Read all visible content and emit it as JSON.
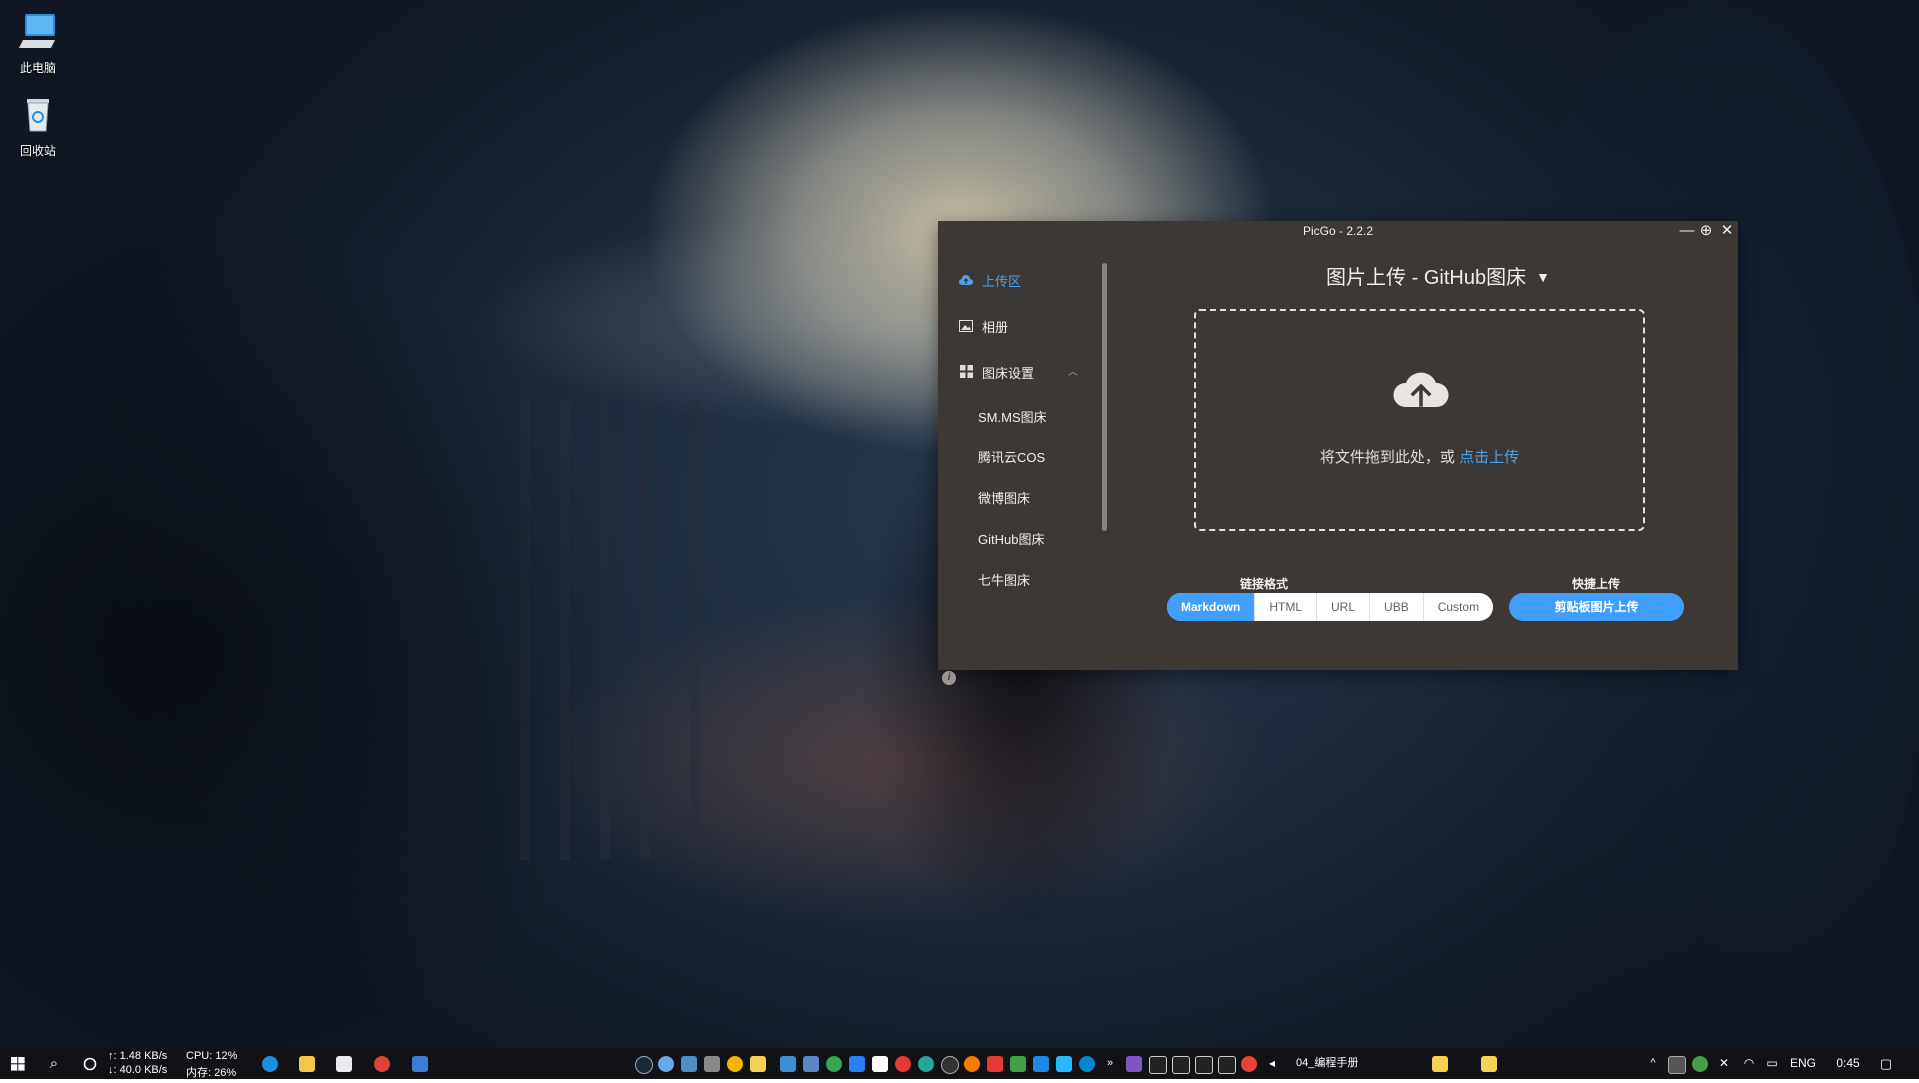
{
  "desktop": {
    "icons": [
      {
        "label": "此电脑",
        "icon": "computer-icon"
      },
      {
        "label": "回收站",
        "icon": "recycle-bin-icon"
      }
    ]
  },
  "window": {
    "title": "PicGo - 2.2.2",
    "controls": {
      "minimize": "—",
      "pin": "⊕",
      "close": "✕"
    }
  },
  "sidebar": {
    "items": [
      {
        "label": "上传区",
        "icon": "cloud-upload-icon",
        "active": true
      },
      {
        "label": "相册",
        "icon": "image-icon"
      },
      {
        "label": "图床设置",
        "icon": "grid-icon",
        "expanded": true
      }
    ],
    "sub_items": [
      "SM.MS图床",
      "腾讯云COS",
      "微博图床",
      "GitHub图床",
      "七牛图床"
    ],
    "info_icon": "i"
  },
  "main": {
    "title": "图片上传 - GitHub图床",
    "dropzone": {
      "hint": "将文件拖到此处，或 ",
      "link": "点击上传"
    },
    "link_format": {
      "label": "链接格式",
      "options": [
        "Markdown",
        "HTML",
        "URL",
        "UBB",
        "Custom"
      ],
      "selected": "Markdown"
    },
    "quick_upload": {
      "label": "快捷上传",
      "button": "剪贴板图片上传"
    }
  },
  "taskbar": {
    "net_up": "↑: 1.48 KB/s",
    "net_down": "↓: 40.0 KB/s",
    "cpu": "CPU: 12%",
    "mem": "内存: 26%",
    "task_label": "04_编程手册",
    "lang": "ENG",
    "time": "0:45"
  },
  "colors": {
    "window_bg": "#3d3834",
    "accent": "#409eff",
    "link": "#4aa3f0",
    "taskbar_bg": "#101216"
  }
}
